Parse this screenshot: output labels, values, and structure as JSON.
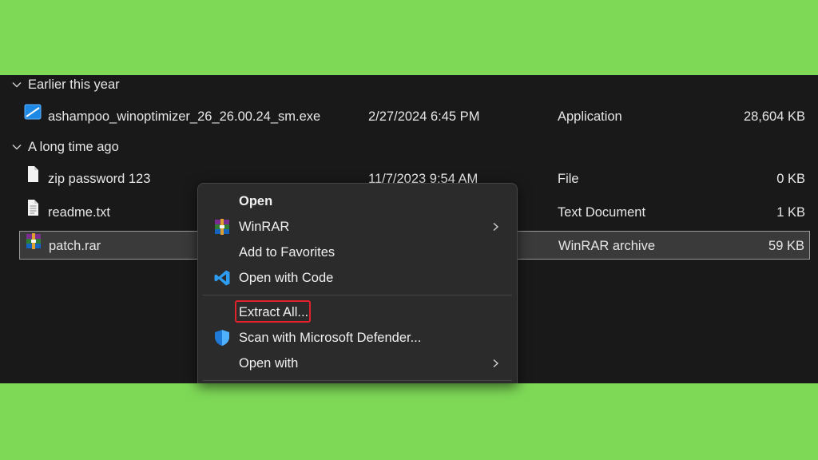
{
  "groups": {
    "earlier": "Earlier this year",
    "long_ago": "A long time ago"
  },
  "files": [
    {
      "name": "ashampoo_winoptimizer_26_26.00.24_sm.exe",
      "date": "2/27/2024 6:45 PM",
      "type": "Application",
      "size": "28,604 KB",
      "icon": "app-icon"
    },
    {
      "name": "zip password 123",
      "date": "11/7/2023 9:54 AM",
      "type": "File",
      "size": "0 KB",
      "icon": "file-icon"
    },
    {
      "name": "readme.txt",
      "date": "",
      "type": "Text Document",
      "size": "1 KB",
      "icon": "text-file-icon"
    },
    {
      "name": "patch.rar",
      "date": "",
      "type": "WinRAR archive",
      "size": "59 KB",
      "icon": "winrar-archive-icon",
      "selected": true
    }
  ],
  "context_menu": {
    "open": "Open",
    "winrar": "WinRAR",
    "add_favorites": "Add to Favorites",
    "open_with_code": "Open with Code",
    "extract_all": "Extract All...",
    "scan_defender": "Scan with Microsoft Defender...",
    "open_with": "Open with"
  },
  "colors": {
    "background": "#7ed957",
    "window": "#191919",
    "menu": "#2b2b2b",
    "highlight": "#e0202a"
  }
}
